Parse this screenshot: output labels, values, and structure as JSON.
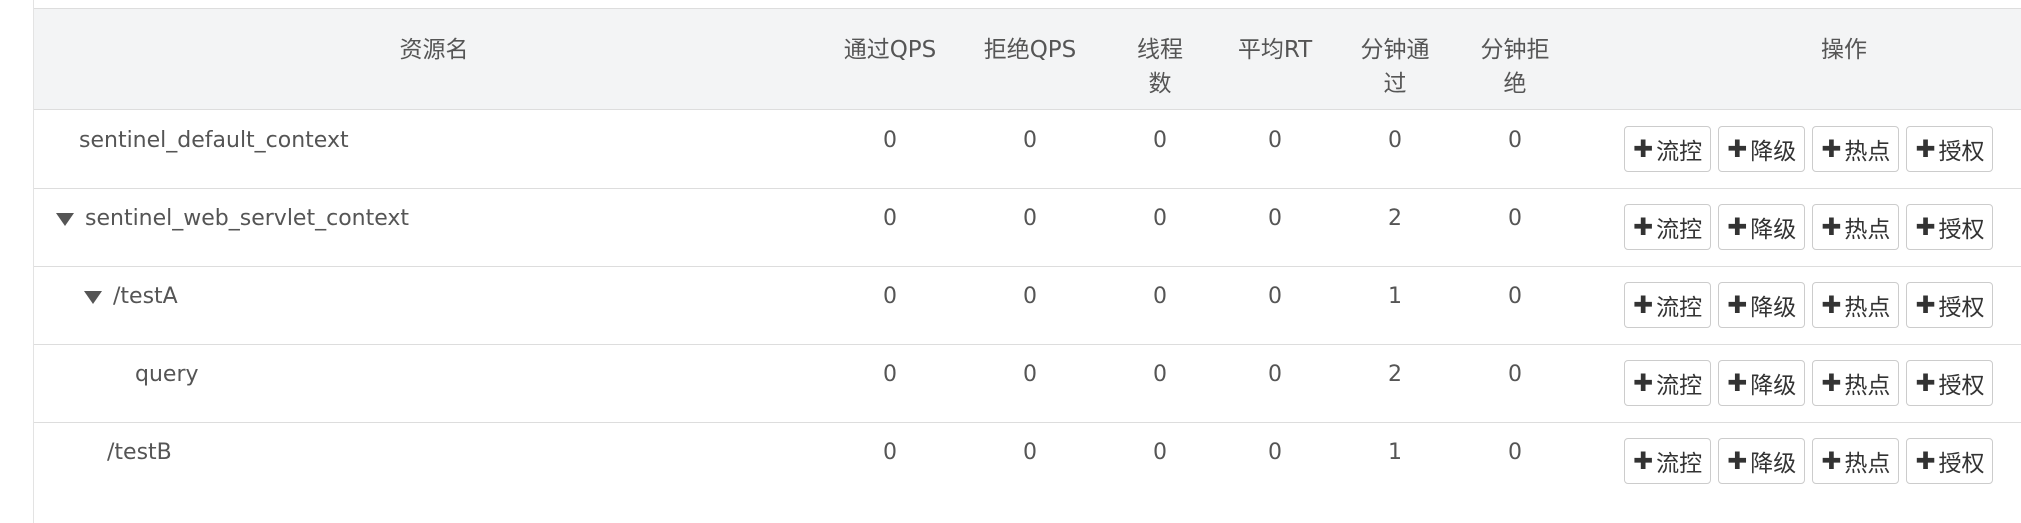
{
  "headers": {
    "resource": "资源名",
    "pass_qps": "通过QPS",
    "block_qps": "拒绝QPS",
    "threads": "线程\n数",
    "avg_rt": "平均RT",
    "minute_pass": "分钟通\n过",
    "minute_block": "分钟拒\n绝",
    "actions": "操作"
  },
  "actions": {
    "flow": "流控",
    "degrade": "降级",
    "hotspot": "热点",
    "authority": "授权",
    "plus_icon": "plus-icon"
  },
  "rows": [
    {
      "name": "sentinel_default_context",
      "pass_qps": "0",
      "block_qps": "0",
      "threads": "0",
      "avg_rt": "0",
      "minute_pass": "0",
      "minute_block": "0"
    },
    {
      "name": "sentinel_web_servlet_context",
      "pass_qps": "0",
      "block_qps": "0",
      "threads": "0",
      "avg_rt": "0",
      "minute_pass": "2",
      "minute_block": "0"
    },
    {
      "name": "/testA",
      "pass_qps": "0",
      "block_qps": "0",
      "threads": "0",
      "avg_rt": "0",
      "minute_pass": "1",
      "minute_block": "0"
    },
    {
      "name": "query",
      "pass_qps": "0",
      "block_qps": "0",
      "threads": "0",
      "avg_rt": "0",
      "minute_pass": "2",
      "minute_block": "0"
    },
    {
      "name": "/testB",
      "pass_qps": "0",
      "block_qps": "0",
      "threads": "0",
      "avg_rt": "0",
      "minute_pass": "1",
      "minute_block": "0"
    }
  ]
}
